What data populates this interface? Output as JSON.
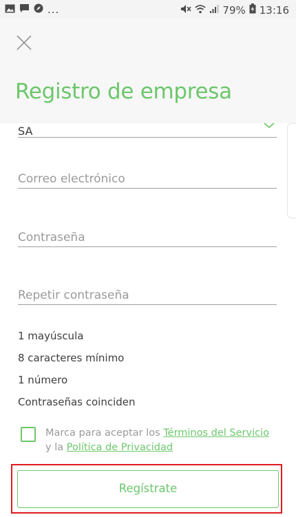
{
  "status_bar": {
    "left_icons": [
      "image-icon",
      "message-icon",
      "compass-icon"
    ],
    "more": "...",
    "right_icons": [
      "mute-icon",
      "wifi-icon",
      "signal-icon",
      "battery-icon"
    ],
    "battery_percent": "79%",
    "time": "13:16"
  },
  "header": {
    "title": "Registro de empresa",
    "close_icon": "close-icon"
  },
  "form": {
    "company_type_value": "SA",
    "email_placeholder": "Correo electrónico",
    "password_placeholder": "Contraseña",
    "password_repeat_placeholder": "Repetir contraseña"
  },
  "password_rules": [
    "1 mayúscula",
    "8 caracteres mínimo",
    "1 número",
    "Contraseñas coinciden"
  ],
  "terms": {
    "prefix": "Marca para aceptar los ",
    "terms_link": "Términos del Servicio",
    "middle": "y la ",
    "privacy_link": "Política de Privacidad"
  },
  "register_button": "Regístrate",
  "colors": {
    "accent": "#6cc76b",
    "highlight": "#e0191f"
  }
}
